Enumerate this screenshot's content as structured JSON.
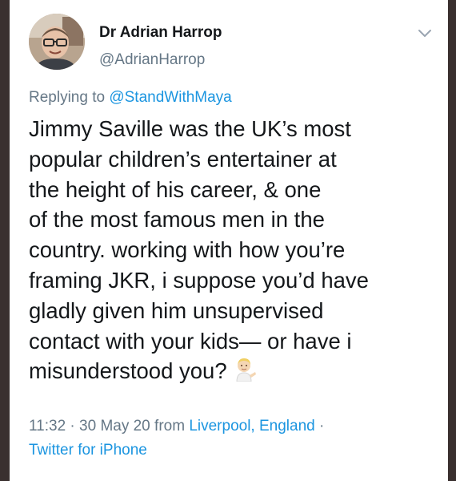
{
  "tweet": {
    "display_name": "Dr Adrian Harrop",
    "handle": "@AdrianHarrop",
    "reply_prefix": "Replying to",
    "reply_to": "@StandWithMaya",
    "lines": [
      "Jimmy Saville was the UK’s most",
      "popular children’s entertainer at",
      "the height of his career, & one",
      "of the most famous men in the",
      "country. working with how you’re",
      "framing JKR, i suppose you’d have",
      "gladly given him unsupervised",
      "contact with your kids— or have i",
      "misunderstood you?"
    ],
    "time": "11:32",
    "sep": "·",
    "date": "30 May 20",
    "from_label": "from",
    "location": "Liverpool, England",
    "sep2": "·",
    "source": "Twitter for iPhone"
  },
  "icons": {
    "menu": "chevron-down-icon",
    "emoji": "person-tipping-hand-emoji"
  },
  "colors": {
    "link": "#1b95e0",
    "muted": "#657786",
    "text": "#14171a",
    "frame": "#3a302f"
  }
}
